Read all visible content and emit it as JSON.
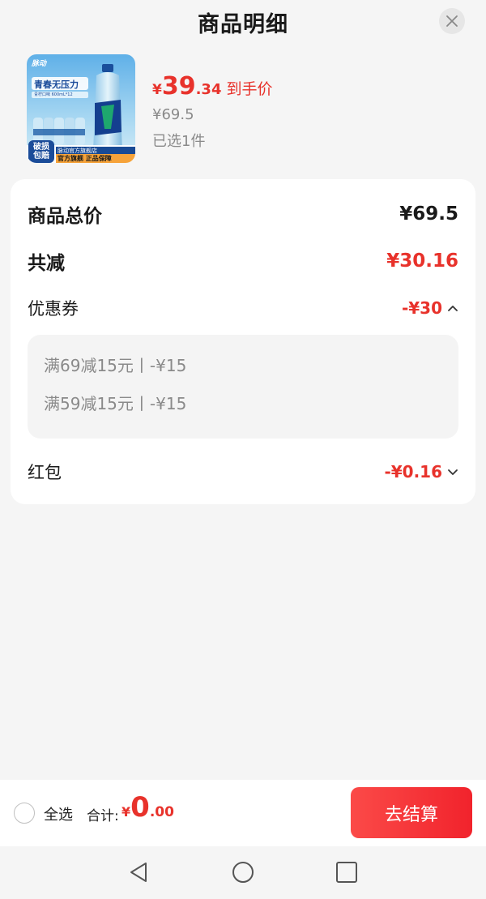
{
  "header": {
    "title": "商品明细",
    "close_icon": "close-icon"
  },
  "product": {
    "image_alt_icon": "product-thumbnail",
    "thumb_text": {
      "brand": "脉动",
      "slogan": "青春无压力",
      "spec": "青柠口味 600mL*12",
      "badge": "破损包赔",
      "banner_top": "脉动官方旗舰店",
      "banner_bottom": "官方旗舰 正品保障"
    },
    "price_symbol": "¥",
    "price_int": "39",
    "price_dec": ".34",
    "price_tag": "到手价",
    "original_price": "¥69.5",
    "selected_count": "已选1件"
  },
  "details": {
    "total_label": "商品总价",
    "total_value": "¥69.5",
    "reduce_label": "共减",
    "reduce_value": "¥30.16",
    "coupon_label": "优惠券",
    "coupon_value": "-¥30",
    "coupons": [
      "满69减15元丨-¥15",
      "满59减15元丨-¥15"
    ],
    "redpacket_label": "红包",
    "redpacket_value": "-¥0.16"
  },
  "bottom_bar": {
    "select_all": "全选",
    "total_label": "合计:",
    "total_symbol": "¥",
    "total_int": "0",
    "total_dec": ".00",
    "checkout_label": "去结算"
  },
  "colors": {
    "accent_red": "#e8322b",
    "checkout_start": "#fb4a48",
    "checkout_end": "#f1232c",
    "muted_text": "#8a8a8a"
  }
}
